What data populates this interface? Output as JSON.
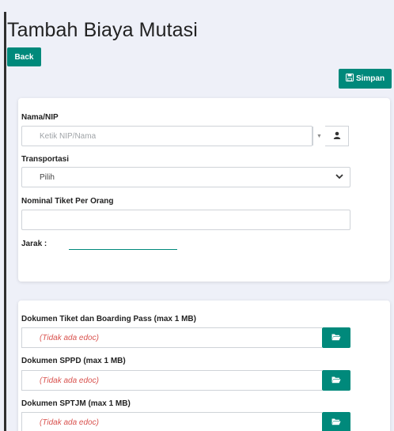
{
  "page": {
    "title": "Tambah Biaya Mutasi"
  },
  "toolbar": {
    "back_label": "Back",
    "save_label": "Simpan"
  },
  "form": {
    "nip": {
      "label": "Nama/NIP",
      "placeholder": "Ketik NIP/Nama"
    },
    "transport": {
      "label": "Transportasi",
      "selected": "Pilih"
    },
    "ticket": {
      "label": "Nominal Tiket Per Orang",
      "value": ""
    },
    "distance": {
      "label": "Jarak :"
    }
  },
  "documents": [
    {
      "label": "Dokumen Tiket dan Boarding Pass (max 1 MB)",
      "status": "(Tidak ada edoc)"
    },
    {
      "label": "Dokumen SPPD (max 1 MB)",
      "status": "(Tidak ada edoc)"
    },
    {
      "label": "Dokumen SPTJM (max 1 MB)",
      "status": "(Tidak ada edoc)"
    }
  ],
  "icons": {
    "save": "save-icon",
    "user": "user-icon",
    "folder": "folder-open-icon",
    "caret": "caret-down-icon",
    "chevron": "chevron-down-icon"
  },
  "colors": {
    "accent": "#00897b",
    "empty_status": "#d9534f"
  }
}
